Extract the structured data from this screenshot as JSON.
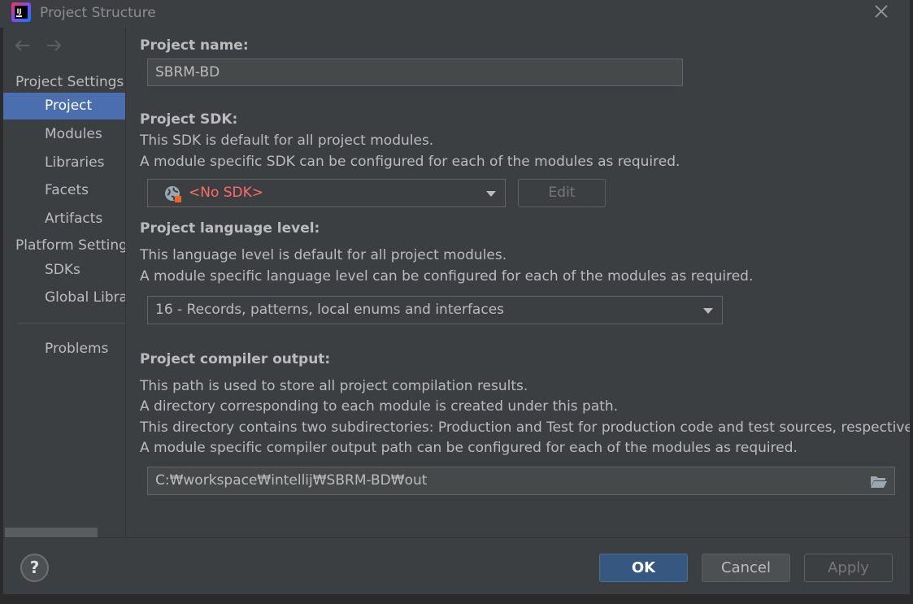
{
  "window": {
    "title": "Project Structure"
  },
  "nav": {
    "back_icon": "arrow-left-icon",
    "forward_icon": "arrow-right-icon"
  },
  "sidebar": {
    "project_settings_header": "Project Settings",
    "platform_settings_header": "Platform Settings",
    "items": [
      {
        "label": "Project",
        "selected": true
      },
      {
        "label": "Modules"
      },
      {
        "label": "Libraries"
      },
      {
        "label": "Facets"
      },
      {
        "label": "Artifacts"
      },
      {
        "label": "SDKs"
      },
      {
        "label": "Global Libraries"
      },
      {
        "label": "Problems"
      }
    ]
  },
  "main": {
    "project_name": {
      "label": "Project name:",
      "value": "SBRM-BD"
    },
    "project_sdk": {
      "label": "Project SDK:",
      "desc1": "This SDK is default for all project modules.",
      "desc2": "A module specific SDK can be configured for each of the modules as required.",
      "selected": "<No SDK>",
      "edit_label": "Edit"
    },
    "language_level": {
      "label": "Project language level:",
      "desc1": "This language level is default for all project modules.",
      "desc2": "A module specific language level can be configured for each of the modules as required.",
      "selected": "16 - Records, patterns, local enums and interfaces"
    },
    "compiler_output": {
      "label": "Project compiler output:",
      "desc1": "This path is used to store all project compilation results.",
      "desc2": "A directory corresponding to each module is created under this path.",
      "desc3": "This directory contains two subdirectories: Production and Test for production code and test sources, respectively.",
      "desc4": "A module specific compiler output path can be configured for each of the modules as required.",
      "path": "C:₩workspace₩intellij₩SBRM-BD₩out"
    }
  },
  "footer": {
    "help": "?",
    "ok": "OK",
    "cancel": "Cancel",
    "apply": "Apply"
  },
  "colors": {
    "accent": "#4b6eaf",
    "ok_button": "#365880",
    "error_text": "#ff6b68",
    "background": "#3c3f41"
  }
}
